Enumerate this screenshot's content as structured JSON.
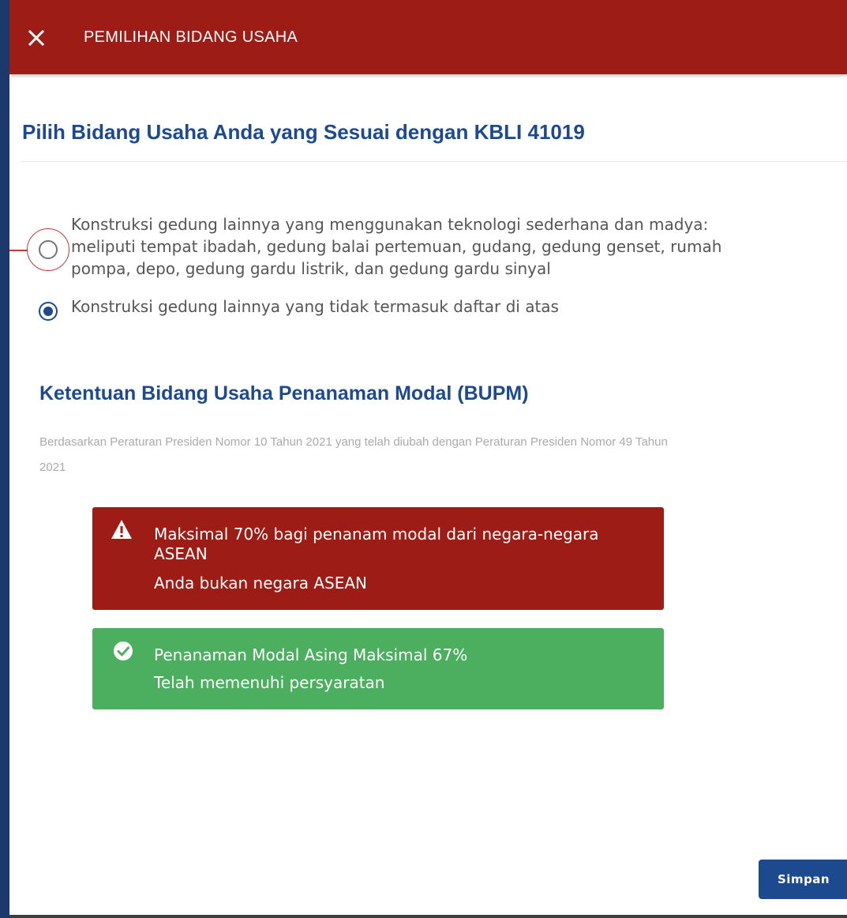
{
  "header": {
    "close_icon": "close-icon",
    "title": "PEMILIHAN BIDANG USAHA"
  },
  "section": {
    "title": "Pilih Bidang Usaha Anda yang Sesuai dengan KBLI 41019"
  },
  "options": [
    {
      "lines": [
        "Konstruksi gedung lainnya yang menggunakan teknologi sederhana dan madya:",
        "meliputi tempat ibadah, gedung balai pertemuan, gudang, gedung genset, rumah",
        "pompa, depo, gedung gardu listrik, dan gedung gardu sinyal"
      ],
      "selected": false
    },
    {
      "lines": [
        "Konstruksi gedung lainnya yang tidak termasuk daftar di atas"
      ],
      "selected": true
    }
  ],
  "bupm": {
    "title": "Ketentuan Bidang Usaha Penanaman Modal (BUPM)",
    "description_line1": "Berdasarkan Peraturan Presiden Nomor 10 Tahun 2021 yang telah diubah dengan Peraturan Presiden Nomor 49 Tahun",
    "description_line2": "2021"
  },
  "alerts": {
    "warning": {
      "icon": "warning-icon",
      "color": "#9d1c16",
      "line1": "Maksimal 70% bagi penanam modal dari negara-negara",
      "line2": "ASEAN",
      "line3": "Anda bukan negara ASEAN"
    },
    "success": {
      "icon": "check-circle-icon",
      "color": "#4caf5f",
      "line1": "Penanaman Modal Asing Maksimal 67%",
      "line2": "Telah memenuhi persyaratan"
    }
  },
  "footer": {
    "save_label": "Simpan"
  },
  "colors": {
    "header": "#9d1c16",
    "accent": "#1d4a8f",
    "backdrop": "#1b3a6b"
  }
}
